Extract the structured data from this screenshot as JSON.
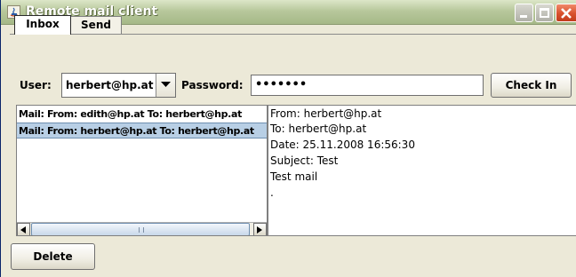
{
  "window": {
    "title": "Remote mail client",
    "icons": [
      "java-app-icon",
      "minimize-icon",
      "maximize-icon",
      "close-icon"
    ]
  },
  "tabs": [
    {
      "label": "Inbox",
      "selected": true
    },
    {
      "label": "Send",
      "selected": false
    }
  ],
  "form": {
    "user_label": "User:",
    "user_value": "herbert@hp.at",
    "password_label": "Password:",
    "password_value": "•••••••",
    "check_in_label": "Check In"
  },
  "mail_list": {
    "items": [
      {
        "text": "Mail: From: edith@hp.at To: herbert@hp.at",
        "selected": false
      },
      {
        "text": "Mail: From: herbert@hp.at To: herbert@hp.at",
        "selected": true
      }
    ]
  },
  "detail": {
    "lines": [
      "From: herbert@hp.at",
      "To: herbert@hp.at",
      "Date: 25.11.2008 16:56:30",
      "Subject: Test",
      "Test mail",
      "."
    ]
  },
  "actions": {
    "delete_label": "Delete"
  },
  "colors": {
    "window_bg": "#ece9d8",
    "selection": "#b8cfe5",
    "close_button": "#d8502c"
  }
}
